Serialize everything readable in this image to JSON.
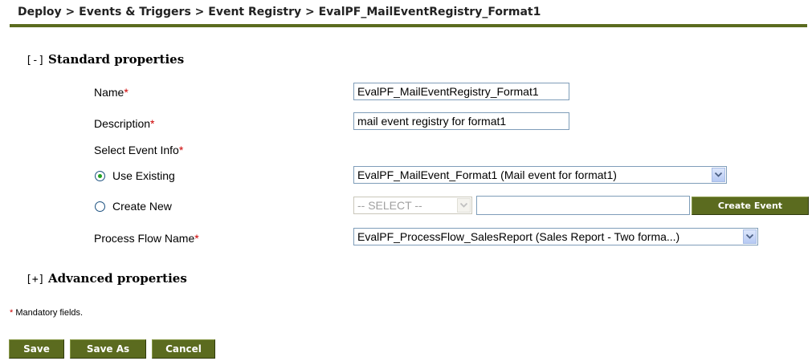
{
  "breadcrumb": "Deploy > Events & Triggers > Event Registry > EvalPF_MailEventRegistry_Format1",
  "standard_section": {
    "toggle": "[-]",
    "title": "Standard properties"
  },
  "advanced_section": {
    "toggle": "[+]",
    "title": "Advanced properties"
  },
  "required_marker": "*",
  "fields": {
    "name": {
      "label": "Name",
      "value": "EvalPF_MailEventRegistry_Format1"
    },
    "description": {
      "label": "Description",
      "value": "mail event registry for format1"
    },
    "event_info_label": "Select Event Info",
    "use_existing": {
      "label": "Use Existing",
      "checked": true,
      "selected": "EvalPF_MailEvent_Format1 (Mail event for format1)"
    },
    "create_new": {
      "label": "Create New",
      "checked": false,
      "select_value": "-- SELECT --",
      "text_value": "",
      "button_label": "Create Event"
    },
    "process_flow": {
      "label": "Process Flow Name",
      "selected": "EvalPF_ProcessFlow_SalesReport (Sales Report - Two forma...)"
    }
  },
  "mandatory_note": "Mandatory fields.",
  "buttons": {
    "save": "Save",
    "save_as": "Save As",
    "cancel": "Cancel"
  },
  "colors": {
    "accent": "#5b6b1f",
    "required": "#cc0000",
    "radio_selected": "#21a121"
  }
}
